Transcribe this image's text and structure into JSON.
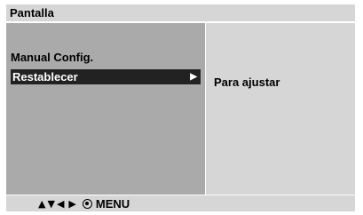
{
  "title": "Pantalla",
  "menu": {
    "items": [
      {
        "label": "Manual Config.",
        "selected": false
      },
      {
        "label": "Restablecer",
        "selected": true
      }
    ]
  },
  "detail": {
    "text": "Para ajustar"
  },
  "footer": {
    "up_icon": "▲",
    "down_icon": "▼",
    "left_icon": "◀",
    "right_icon": "▶",
    "menu_label": "MENU"
  },
  "colors": {
    "panel_light": "#d6d6d6",
    "panel_dark": "#aaaaaa",
    "highlight": "#222222"
  }
}
